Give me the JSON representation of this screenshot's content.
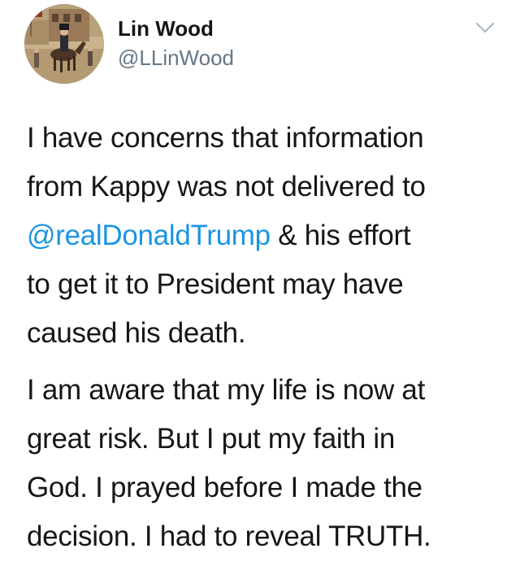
{
  "author": {
    "display_name": "Lin Wood",
    "handle": "@LLinWood",
    "avatar_icon": "avatar-painting-horseman"
  },
  "menu": {
    "caret_icon": "chevron-down-icon"
  },
  "tweet": {
    "paragraph1": {
      "line1": "I have concerns that information",
      "line2": "from Kappy was not delivered to",
      "mention": "@realDonaldTrump",
      "line3_rest": " & his effort",
      "line4": "to get it to President may have",
      "line5": "caused his death."
    },
    "paragraph2": {
      "line1": "I am aware that my life is now at",
      "line2": "great risk. But I put my faith in",
      "line3": "God. I prayed before I made the",
      "line4": "decision. I had to reveal TRUTH."
    }
  },
  "colors": {
    "text": "#14171a",
    "handle": "#657786",
    "link": "#1b95e0",
    "caret": "#aab8c2"
  }
}
